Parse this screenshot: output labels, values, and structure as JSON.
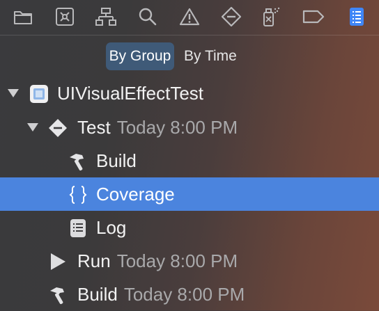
{
  "toolbar": {
    "icons": [
      "folder-icon",
      "source-control-icon",
      "hierarchy-icon",
      "search-icon",
      "warning-icon",
      "test-diamond-icon",
      "debug-spray-icon",
      "tag-icon",
      "report-list-icon"
    ],
    "active_icon": "report-list-icon",
    "accent_color": "#3f86f7"
  },
  "segmented": {
    "by_group": "By Group",
    "by_time": "By Time",
    "selected": "By Group"
  },
  "tree": {
    "root": {
      "label": "UIVisualEffectTest",
      "icon": "project-icon",
      "expanded": true
    },
    "test": {
      "label": "Test",
      "time": "Today 8:00 PM",
      "icon": "test-diamond-icon",
      "expanded": true
    },
    "test_build": {
      "label": "Build",
      "icon": "hammer-icon"
    },
    "test_coverage": {
      "label": "Coverage",
      "icon": "braces-icon",
      "selected": true
    },
    "test_log": {
      "label": "Log",
      "icon": "log-list-icon"
    },
    "run": {
      "label": "Run",
      "time": "Today 8:00 PM",
      "icon": "play-icon"
    },
    "build": {
      "label": "Build",
      "time": "Today 8:00 PM",
      "icon": "hammer-icon"
    }
  },
  "colors": {
    "selection": "#4b84de",
    "segment_active": "#3f5a78",
    "secondary_text": "#a9a9ab"
  }
}
